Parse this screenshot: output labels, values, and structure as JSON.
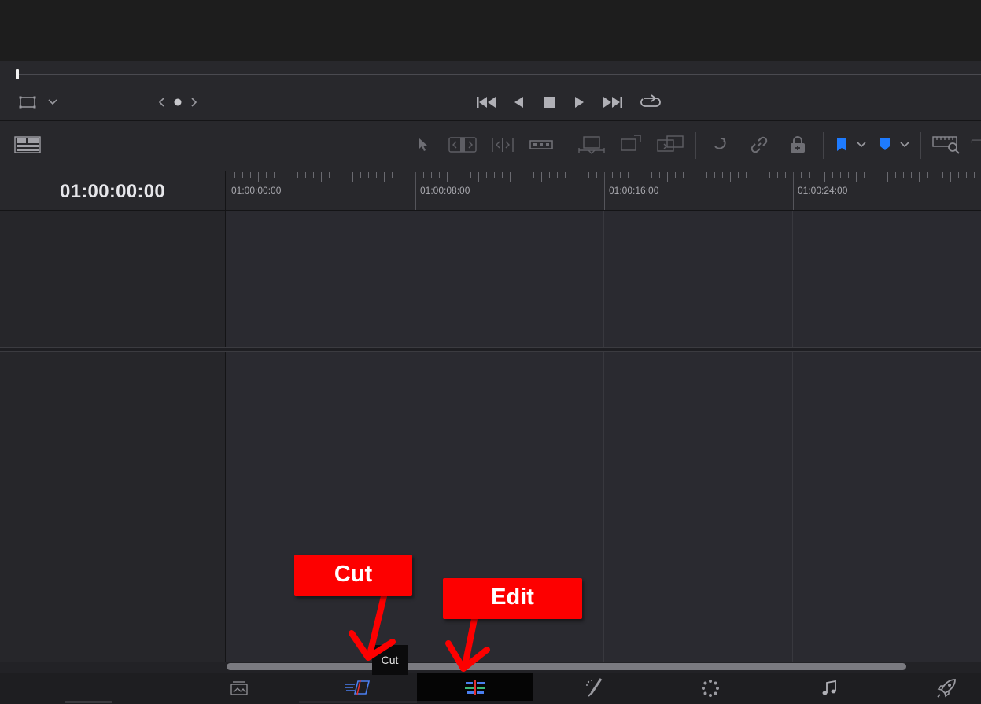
{
  "timeline": {
    "timecode": "01:00:00:00",
    "ruler_labels": [
      "01:00:00:00",
      "01:00:08:00",
      "01:00:16:00",
      "01:00:24:00"
    ]
  },
  "viewer_controls": {
    "transport_icons": [
      "jump-to-start-icon",
      "play-reverse-icon",
      "stop-icon",
      "play-icon",
      "jump-to-end-icon",
      "loop-icon"
    ]
  },
  "toolbar": {
    "icons": [
      "timeline-view-options-icon",
      "selection-tool-icon",
      "trim-tool-icon",
      "dynamic-trim-icon",
      "blade-tool-icon",
      "insert-clip-icon",
      "overwrite-clip-icon",
      "replace-clip-icon",
      "snapping-icon",
      "linked-selection-icon",
      "position-lock-icon",
      "flag-icon",
      "marker-icon",
      "zoom-icon"
    ]
  },
  "tooltip": {
    "text": "Cut"
  },
  "annotations": {
    "cut_label": "Cut",
    "edit_label": "Edit"
  },
  "page_bar": {
    "pages": [
      "media",
      "cut",
      "edit",
      "fusion",
      "color",
      "fairlight",
      "deliver"
    ],
    "active_page": "edit"
  },
  "colors": {
    "accent_blue": "#1e7bff",
    "callout_red": "#fd0000",
    "background": "#1c1c1f"
  }
}
